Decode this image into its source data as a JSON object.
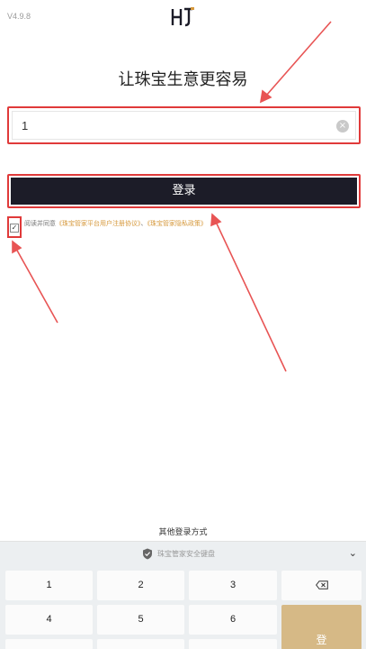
{
  "version": "V4.9.8",
  "logo": "HJ",
  "headline": "让珠宝生意更容易",
  "phone_input": {
    "value": "1",
    "clear_glyph": "×"
  },
  "login_button": {
    "label": "登录"
  },
  "agreement": {
    "prefix": "阅读并同意",
    "link1": "《珠宝管家平台用户注册协议》",
    "separator": "、",
    "link2": "《珠宝管家隐私政策》",
    "checked_glyph": "✓"
  },
  "other_login": "其他登录方式",
  "keyboard": {
    "title": "珠宝管家安全键盘",
    "collapse_glyph": "⌄",
    "keys": [
      "1",
      "2",
      "3",
      "4",
      "5",
      "6"
    ],
    "login_key": "登"
  },
  "colors": {
    "accent_red": "#e03a3a",
    "button_dark": "#1c1c28",
    "gold": "#d6b986",
    "link": "#d6983b"
  }
}
